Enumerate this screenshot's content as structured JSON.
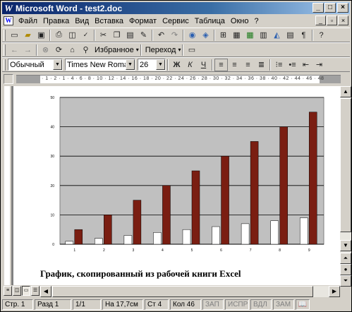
{
  "window": {
    "title": "Microsoft Word - test2.doc",
    "app_icon": "word-icon",
    "buttons": {
      "minimize": "_",
      "maximize": "□",
      "close": "×"
    }
  },
  "menu": {
    "items": [
      "Файл",
      "Правка",
      "Вид",
      "Вставка",
      "Формат",
      "Сервис",
      "Таблица",
      "Окно",
      "?"
    ],
    "doc_buttons": {
      "minimize": "_",
      "restore": "▫",
      "close": "×"
    }
  },
  "standard_toolbar": {
    "icons": [
      "new-icon",
      "open-icon",
      "save-icon",
      "print-icon",
      "print-preview-icon",
      "spelling-icon",
      "cut-icon",
      "copy-icon",
      "paste-icon",
      "format-painter-icon",
      "undo-icon",
      "redo-icon",
      "hyperlink-icon",
      "web-toolbar-icon",
      "tables-borders-icon",
      "insert-table-icon",
      "insert-excel-icon",
      "columns-icon",
      "drawing-icon",
      "document-map-icon",
      "show-hide-icon",
      "zoom-icon",
      "help-icon"
    ]
  },
  "web_toolbar": {
    "favorites_label": "Избранное",
    "goto_label": "Переход"
  },
  "format_toolbar": {
    "style": "Обычный",
    "font": "Times New Roman",
    "size": "26",
    "bold": "Ж",
    "italic": "К",
    "underline": "Ч"
  },
  "ruler": {
    "ticks": "· 1 · 2 · 1 · 4 · 6 · 8 · 10 · 12 · 14 · 16 · 18 · 20 · 22 · 24 · 26 · 28 · 30 · 32 · 34 · 36 · 38 · 40 · 42 · 44 · 46 · 48"
  },
  "document": {
    "caption": "График, скопированный из рабочей книги Excel"
  },
  "chart_data": {
    "type": "bar",
    "categories": [
      "1",
      "2",
      "3",
      "4",
      "5",
      "6",
      "7",
      "8",
      "9"
    ],
    "series": [
      {
        "values": [
          1,
          2,
          3,
          4,
          5,
          6,
          7,
          8,
          9
        ],
        "color": "#ffffff"
      },
      {
        "values": [
          5,
          10,
          15,
          20,
          25,
          30,
          35,
          40,
          45
        ],
        "color": "#7a1e12"
      }
    ],
    "ylim": [
      0,
      50
    ],
    "yticks": [
      "0",
      "10",
      "20",
      "30",
      "40",
      "50"
    ],
    "plot_background": "#c0c0c0",
    "grid": true,
    "legend": "none"
  },
  "status": {
    "page": "Стр. 1",
    "section": "Разд 1",
    "pages": "1/1",
    "position": "На 17,7см",
    "line": "Ст 4",
    "column": "Кол 46",
    "rec": "ЗАП",
    "trk": "ИСПР",
    "ext": "ВДЛ",
    "ovr": "ЗАМ",
    "book_icon": "book-icon"
  }
}
